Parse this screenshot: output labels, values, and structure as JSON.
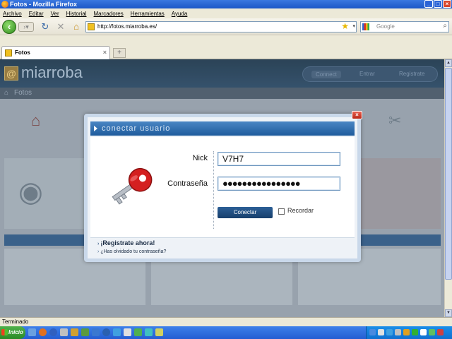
{
  "window": {
    "title": "Fotos - Mozilla Firefox"
  },
  "menu": [
    "Archivo",
    "Editar",
    "Ver",
    "Historial",
    "Marcadores",
    "Herramientas",
    "Ayuda"
  ],
  "nav": {
    "url": "http://fotos.miarroba.es/",
    "search_placeholder": "Google"
  },
  "tab": {
    "title": "Fotos"
  },
  "site": {
    "logo": "miarroba",
    "header_links": [
      "Connect",
      "Entrar",
      "Registrate"
    ],
    "breadcrumb": "Fotos"
  },
  "login": {
    "title": "conectar usuario",
    "nick_label": "Nick",
    "nick_value": "V7H7",
    "password_label": "Contraseña",
    "password_value": "●●●●●●●●●●●●●●●●",
    "connect_button": "Conectar",
    "remember_label": "Recordar",
    "register_link": "¡Registrate ahora!",
    "forgot_link": "¿Has olvidado tu contraseña?"
  },
  "status": {
    "text": "Terminado"
  },
  "taskbar": {
    "start_label": "Inicio"
  },
  "colors": {
    "dialog_header": "#1e5b9c",
    "page_header": "#0e2a40",
    "key_red": "#d42020"
  }
}
